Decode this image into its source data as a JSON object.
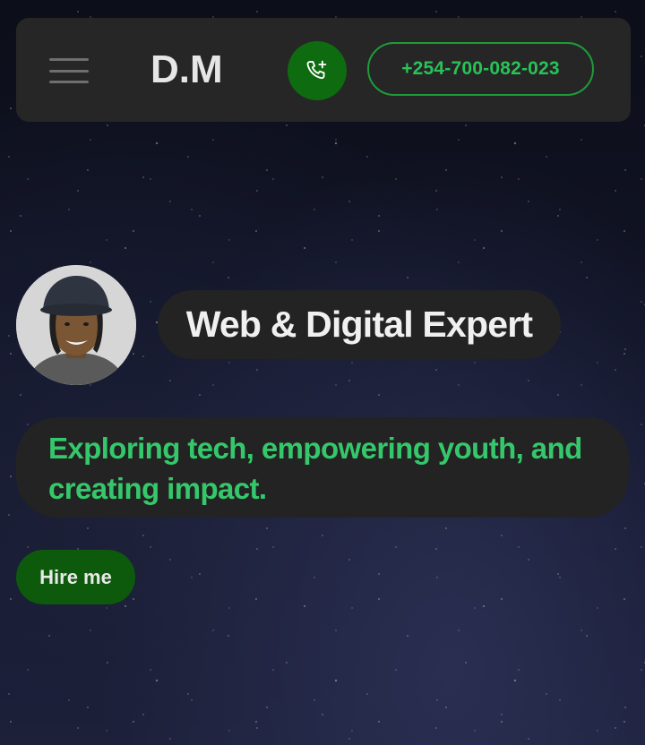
{
  "header": {
    "brand": "D.M",
    "menu_icon": "hamburger-menu-icon",
    "call_icon": "phone-add-icon",
    "phone_number": "+254-700-082-023"
  },
  "hero": {
    "avatar_alt": "profile-photo",
    "title": "Web & Digital Expert",
    "tagline": "Exploring tech, empowering youth, and creating impact.",
    "cta_label": "Hire me"
  },
  "colors": {
    "nav_bg": "#262626",
    "pill_bg": "#232323",
    "accent_green": "#28c257",
    "button_green": "#0d5a0d",
    "call_green": "#0f6b0f",
    "tagline_green": "#35c86b"
  }
}
